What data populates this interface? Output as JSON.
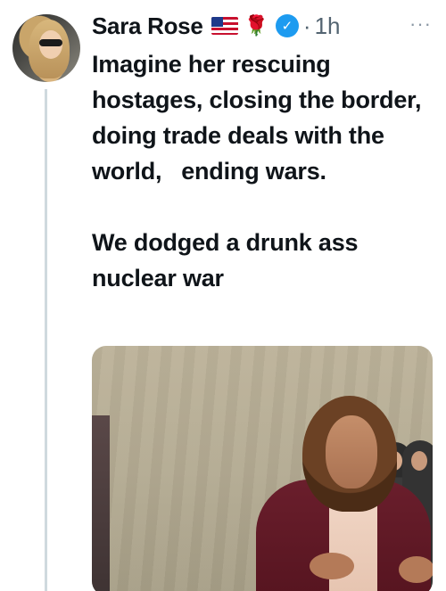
{
  "author": {
    "display_name": "Sara Rose",
    "flag_emoji": "🇺🇸",
    "rose_emoji": "🌹",
    "verified_icon": "verified-badge-icon",
    "separator": "·",
    "timestamp": "1h",
    "more_label": "···"
  },
  "tweet": {
    "paragraphs": [
      "Imagine her rescuing hostages, closing the border, doing trade deals with the world,   ending wars.",
      "We dodged a drunk ass nuclear war"
    ]
  },
  "media": {
    "type": "photo"
  },
  "colors": {
    "text": "#0f1419",
    "secondary": "#536471",
    "verified": "#1d9bf0",
    "thread_line": "#cfd9de"
  }
}
